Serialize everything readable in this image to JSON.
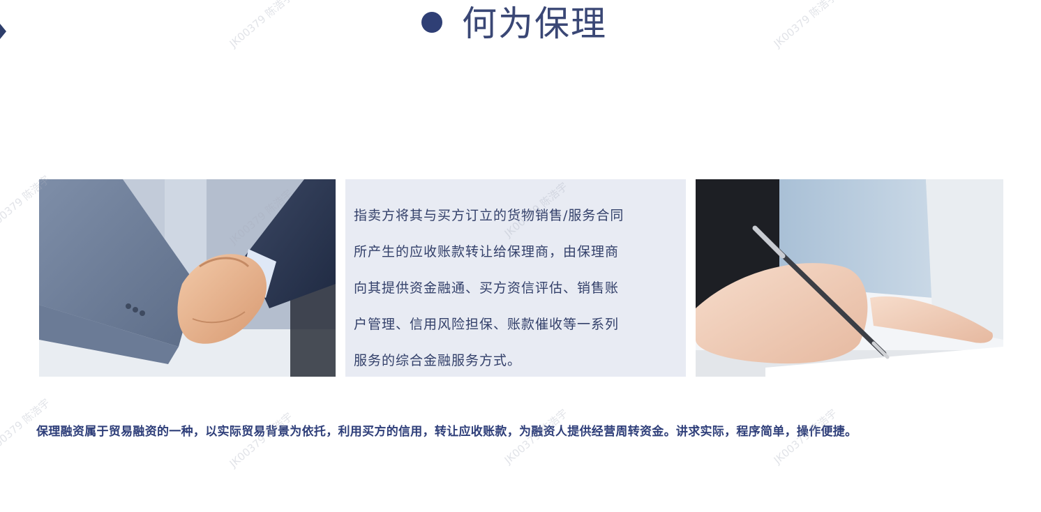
{
  "slide": {
    "title": "何为保理",
    "description_lines": [
      "指卖方将其与买方订立的货物销售/服务合同",
      "所产生的应收账款转让给保理商，由保理商",
      "向其提供资金融通、买方资信评估、销售账",
      "户管理、信用风险担保、账款催收等一系列",
      "服务的综合金融服务方式。"
    ],
    "summary": "保理融资属于贸易融资的一种，以实际贸易背景为依托，利用买方的信用，转让应收账款，为融资人提供经营周转资金。讲求实际，程序简单，操作便捷。"
  },
  "images": {
    "left": "handshake-photo",
    "right": "hand-writing-with-pen-photo"
  },
  "watermarks": [
    {
      "text": "JK00379 陈浩宇"
    },
    {
      "text": "JK00379 陈浩宇"
    },
    {
      "text": "JK00379 陈浩宇"
    },
    {
      "text": "JK00379 陈浩宇"
    },
    {
      "text": "JK00379 陈浩宇"
    },
    {
      "text": "JK00379 陈浩宇"
    },
    {
      "text": "JK00379 陈浩宇"
    },
    {
      "text": "JK00379 陈浩宇"
    },
    {
      "text": "JK00379 陈浩宇"
    }
  ],
  "colors": {
    "title": "#3a4775",
    "accent_dot": "#2f3f75",
    "card_bg": "#e8ebf3",
    "card_text": "#33406a",
    "summary_text": "#2e3e79"
  }
}
